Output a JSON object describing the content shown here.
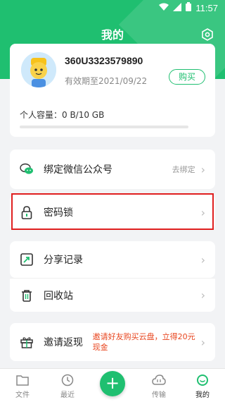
{
  "status_bar": {
    "time": "11:57"
  },
  "header": {
    "title": "我的"
  },
  "profile": {
    "account_id": "360U3323579890",
    "expiry": "有效期至2021/09/22",
    "buy_label": "购买",
    "capacity": "个人容量：0 B/10 GB",
    "capacity_used_fraction": 0
  },
  "menu": {
    "wechat": {
      "label": "绑定微信公众号",
      "hint": "去绑定"
    },
    "password_lock": {
      "label": "密码锁"
    },
    "share_records": {
      "label": "分享记录"
    },
    "recycle_bin": {
      "label": "回收站"
    },
    "invite": {
      "label": "邀请返现",
      "hint": "邀请好友购买云盘，立得20元现金"
    }
  },
  "bottom_nav": {
    "files": "文件",
    "recent": "最近",
    "transfer": "传输",
    "mine": "我的"
  },
  "colors": {
    "accent": "#1fbf70",
    "highlight": "#e01f1f",
    "invite_text": "#e8451e"
  }
}
